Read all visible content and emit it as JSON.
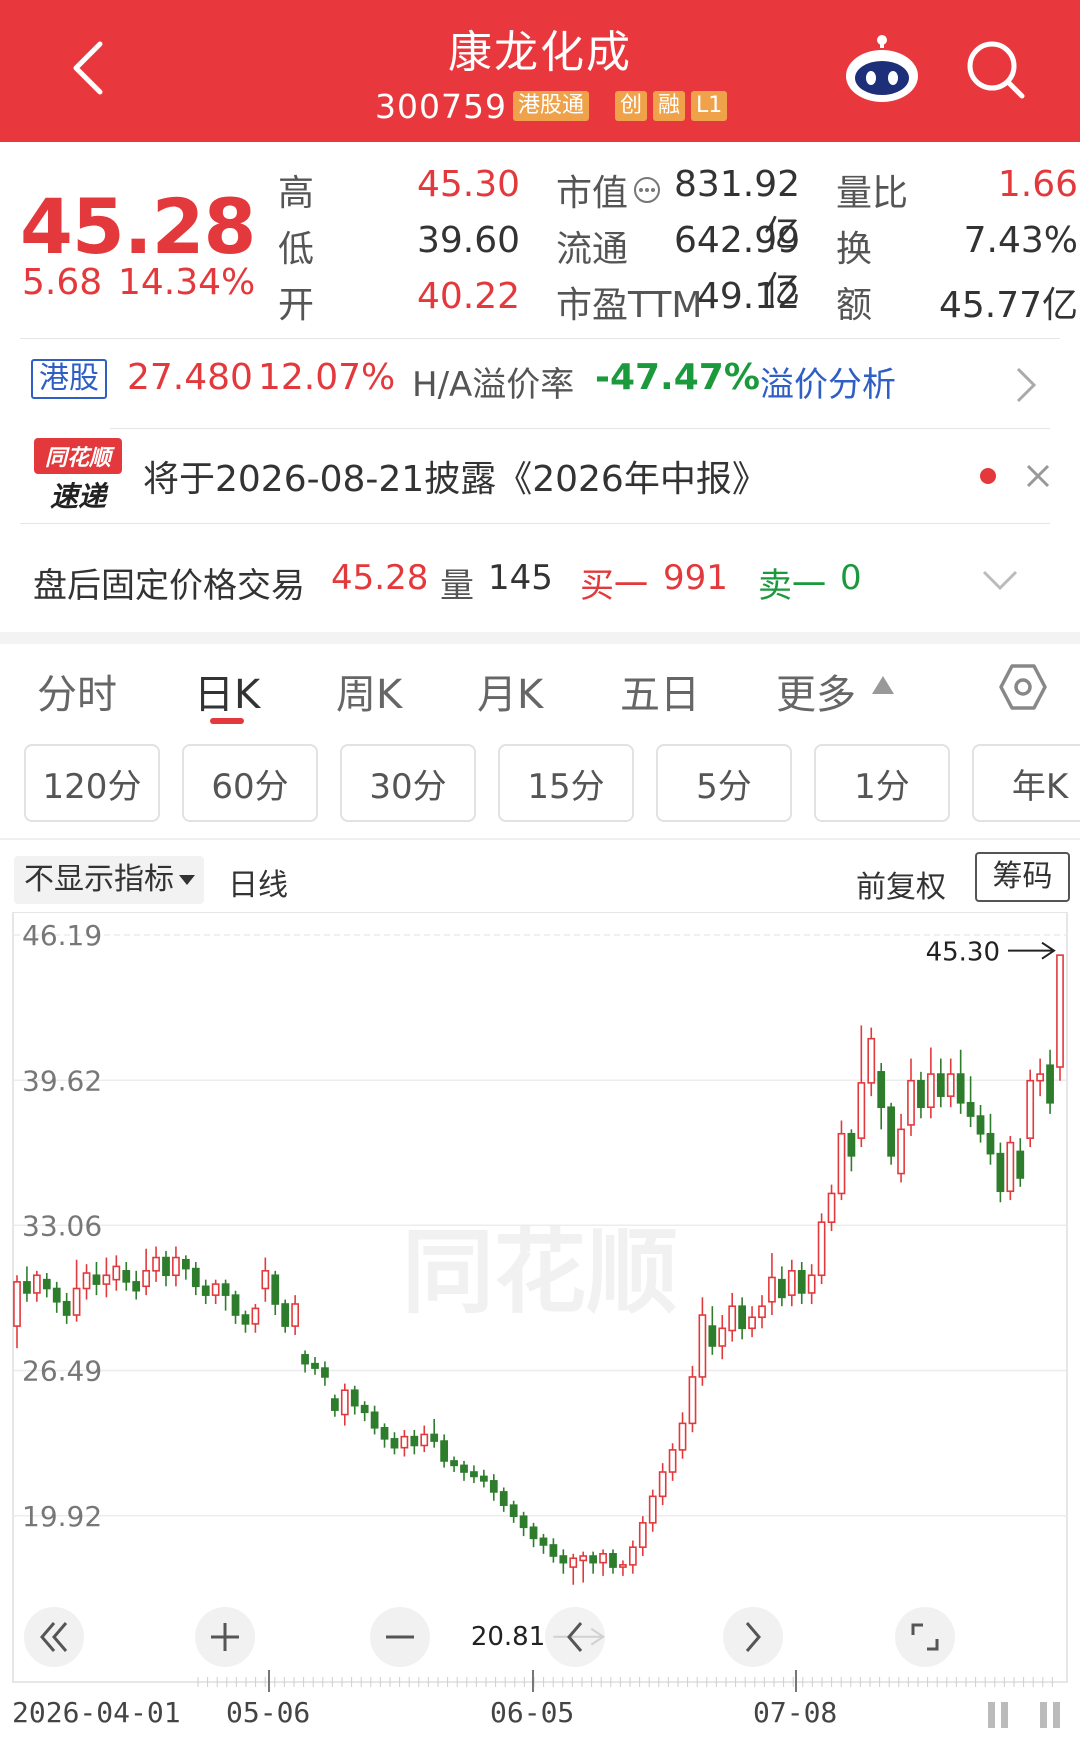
{
  "header": {
    "title": "康龙化成",
    "code": "300759",
    "tags": [
      "港股通",
      "创",
      "融",
      "L1"
    ]
  },
  "quote": {
    "price": "45.28",
    "change": "5.68",
    "change_pct": "14.34%",
    "stats": [
      {
        "label": "高",
        "value": "45.30",
        "color": "red"
      },
      {
        "label": "低",
        "value": "39.60",
        "color": "dark"
      },
      {
        "label": "开",
        "value": "40.22",
        "color": "red"
      },
      {
        "label": "市值",
        "value": "831.92亿",
        "color": "dark"
      },
      {
        "label": "流通",
        "value": "642.99亿",
        "color": "dark"
      },
      {
        "label": "市盈TTM",
        "value": "49.12",
        "color": "dark"
      },
      {
        "label": "量比",
        "value": "1.66",
        "color": "red"
      },
      {
        "label": "换",
        "value": "7.43%",
        "color": "dark"
      },
      {
        "label": "额",
        "value": "45.77亿",
        "color": "dark"
      }
    ]
  },
  "hk": {
    "tag": "港股",
    "price": "27.480",
    "pct": "12.07%",
    "premium_label": "H/A溢价率",
    "premium_value": "-47.47%",
    "link": "溢价分析"
  },
  "news": {
    "logo_top": "同花顺",
    "logo_bottom": "速递",
    "text": "将于2026-08-21披露《2026年中报》"
  },
  "after_hours": {
    "label": "盘后固定价格交易",
    "price": "45.28",
    "vol_label": "量",
    "vol": "145",
    "buy_label": "买一",
    "buy": "991",
    "sell_label": "卖一",
    "sell": "0"
  },
  "tabs": [
    "分时",
    "日K",
    "周K",
    "月K",
    "五日",
    "更多"
  ],
  "active_tab": "日K",
  "periods": [
    "120分",
    "60分",
    "30分",
    "15分",
    "5分",
    "1分",
    "年K"
  ],
  "indicator": {
    "selector": "不显示指标",
    "line": "日线",
    "adjust": "前复权",
    "chip": "筹码"
  },
  "chart_data": {
    "type": "candlestick",
    "ylim": [
      17.92,
      46.19
    ],
    "y_ticks": [
      "46.19",
      "39.62",
      "33.06",
      "26.49",
      "19.92"
    ],
    "x_ticks": [
      "2026-04-01",
      "05-06",
      "06-05",
      "07-08"
    ],
    "high_marker": "45.30",
    "low_marker": "20.81",
    "watermark": "同花顺",
    "colors": {
      "up": "#e4393c",
      "down": "#2d7d2d"
    },
    "candles": [
      [
        28.5,
        30.5,
        27.5,
        30.8
      ],
      [
        30.5,
        30.0,
        29.6,
        31.2
      ],
      [
        30.0,
        30.8,
        29.6,
        31.0
      ],
      [
        30.6,
        30.2,
        29.8,
        30.9
      ],
      [
        30.2,
        29.6,
        29.1,
        30.5
      ],
      [
        29.6,
        29.0,
        28.6,
        30.0
      ],
      [
        29.0,
        30.2,
        28.7,
        31.5
      ],
      [
        30.2,
        30.9,
        29.7,
        31.3
      ],
      [
        30.8,
        30.4,
        29.9,
        31.4
      ],
      [
        30.4,
        30.8,
        29.8,
        31.6
      ],
      [
        30.6,
        31.2,
        30.1,
        31.7
      ],
      [
        31.0,
        30.5,
        30.1,
        31.4
      ],
      [
        30.5,
        30.1,
        29.7,
        31.0
      ],
      [
        30.3,
        31.0,
        29.9,
        32.0
      ],
      [
        31.0,
        31.6,
        30.5,
        32.1
      ],
      [
        31.6,
        30.8,
        30.3,
        31.9
      ],
      [
        30.8,
        31.6,
        30.3,
        32.1
      ],
      [
        31.5,
        31.1,
        30.6,
        31.7
      ],
      [
        31.1,
        30.3,
        29.9,
        31.4
      ],
      [
        30.3,
        29.9,
        29.5,
        30.6
      ],
      [
        29.9,
        30.4,
        29.5,
        30.6
      ],
      [
        30.4,
        29.9,
        29.2,
        30.6
      ],
      [
        29.9,
        29.0,
        28.6,
        30.1
      ],
      [
        29.0,
        28.6,
        28.2,
        29.2
      ],
      [
        28.6,
        29.3,
        28.2,
        29.5
      ],
      [
        30.2,
        31.0,
        29.6,
        31.6
      ],
      [
        30.8,
        29.5,
        29.0,
        31.0
      ],
      [
        29.5,
        28.5,
        28.2,
        29.7
      ],
      [
        28.5,
        29.5,
        28.1,
        29.9
      ],
      [
        27.2,
        26.8,
        26.4,
        27.4
      ],
      [
        26.8,
        26.6,
        26.3,
        27.1
      ],
      [
        26.6,
        26.2,
        25.8,
        26.9
      ],
      [
        25.2,
        24.7,
        24.4,
        25.4
      ],
      [
        24.5,
        25.6,
        24.0,
        25.9
      ],
      [
        25.6,
        24.9,
        24.5,
        25.8
      ],
      [
        24.9,
        24.6,
        24.2,
        25.1
      ],
      [
        24.6,
        23.9,
        23.6,
        24.9
      ],
      [
        23.9,
        23.4,
        23.0,
        24.1
      ],
      [
        23.4,
        23.0,
        22.7,
        23.7
      ],
      [
        23.0,
        23.5,
        22.6,
        23.8
      ],
      [
        23.5,
        23.1,
        22.7,
        23.8
      ],
      [
        23.1,
        23.6,
        22.8,
        24.0
      ],
      [
        23.6,
        23.3,
        23.0,
        24.3
      ],
      [
        23.3,
        22.4,
        22.1,
        23.6
      ],
      [
        22.4,
        22.2,
        21.9,
        22.6
      ],
      [
        22.2,
        21.9,
        21.5,
        22.4
      ],
      [
        21.9,
        21.7,
        21.4,
        22.2
      ],
      [
        21.7,
        21.5,
        21.2,
        22.0
      ],
      [
        21.5,
        21.0,
        20.6,
        21.8
      ],
      [
        21.0,
        20.4,
        20.1,
        21.2
      ],
      [
        20.4,
        19.9,
        19.6,
        20.6
      ],
      [
        19.9,
        19.4,
        19.0,
        20.1
      ],
      [
        19.4,
        18.9,
        18.5,
        19.6
      ],
      [
        18.9,
        18.6,
        18.2,
        19.1
      ],
      [
        18.6,
        18.1,
        17.8,
        18.9
      ],
      [
        18.1,
        17.8,
        17.3,
        18.4
      ],
      [
        17.6,
        18.0,
        16.8,
        18.2
      ],
      [
        17.9,
        18.1,
        16.9,
        18.3
      ],
      [
        18.1,
        17.8,
        17.3,
        18.3
      ],
      [
        17.8,
        18.2,
        17.2,
        18.4
      ],
      [
        18.2,
        17.6,
        17.3,
        18.4
      ],
      [
        17.6,
        17.7,
        17.2,
        17.9
      ],
      [
        17.7,
        18.5,
        17.3,
        18.8
      ],
      [
        18.5,
        19.6,
        18.1,
        19.9
      ],
      [
        19.6,
        20.8,
        19.2,
        21.1
      ],
      [
        20.8,
        21.9,
        20.4,
        22.3
      ],
      [
        21.9,
        22.9,
        21.5,
        23.2
      ],
      [
        22.9,
        24.1,
        22.5,
        24.6
      ],
      [
        24.1,
        26.2,
        23.7,
        26.7
      ],
      [
        26.2,
        29.0,
        25.8,
        29.8
      ],
      [
        28.5,
        27.6,
        27.2,
        29.4
      ],
      [
        27.6,
        28.4,
        27.0,
        29.0
      ],
      [
        28.3,
        29.4,
        27.8,
        30.0
      ],
      [
        29.4,
        28.4,
        27.9,
        29.8
      ],
      [
        28.4,
        28.9,
        28.0,
        29.4
      ],
      [
        28.9,
        29.4,
        28.4,
        29.9
      ],
      [
        29.6,
        30.7,
        29.0,
        31.8
      ],
      [
        30.6,
        29.8,
        29.4,
        31.2
      ],
      [
        29.9,
        31.0,
        29.4,
        31.5
      ],
      [
        31.0,
        30.0,
        29.5,
        31.4
      ],
      [
        30.0,
        30.8,
        29.5,
        31.3
      ],
      [
        30.8,
        33.2,
        30.4,
        33.6
      ],
      [
        33.2,
        34.5,
        32.8,
        34.9
      ],
      [
        34.5,
        37.2,
        34.2,
        37.8
      ],
      [
        37.2,
        36.2,
        35.5,
        37.4
      ],
      [
        37.0,
        39.5,
        36.6,
        42.1
      ],
      [
        39.5,
        41.5,
        38.9,
        42.0
      ],
      [
        40.0,
        38.4,
        37.4,
        40.4
      ],
      [
        38.4,
        36.2,
        35.8,
        38.6
      ],
      [
        35.4,
        37.4,
        35.0,
        38.1
      ],
      [
        37.6,
        39.6,
        37.1,
        40.6
      ],
      [
        39.6,
        38.4,
        37.9,
        40.0
      ],
      [
        38.4,
        39.9,
        37.9,
        41.1
      ],
      [
        39.9,
        38.9,
        38.4,
        40.6
      ],
      [
        38.9,
        39.9,
        38.4,
        40.6
      ],
      [
        39.9,
        38.6,
        38.1,
        41.0
      ],
      [
        38.6,
        38.0,
        37.5,
        39.8
      ],
      [
        38.0,
        37.2,
        36.8,
        38.5
      ],
      [
        37.2,
        36.3,
        35.8,
        38.1
      ],
      [
        36.3,
        34.6,
        34.1,
        36.8
      ],
      [
        34.6,
        36.8,
        34.2,
        37.1
      ],
      [
        36.4,
        35.2,
        34.8,
        37.0
      ],
      [
        37.0,
        39.6,
        36.6,
        40.1
      ],
      [
        39.6,
        39.9,
        38.9,
        40.6
      ],
      [
        40.3,
        38.6,
        38.1,
        41.0
      ],
      [
        40.22,
        45.28,
        39.6,
        45.3
      ]
    ]
  }
}
